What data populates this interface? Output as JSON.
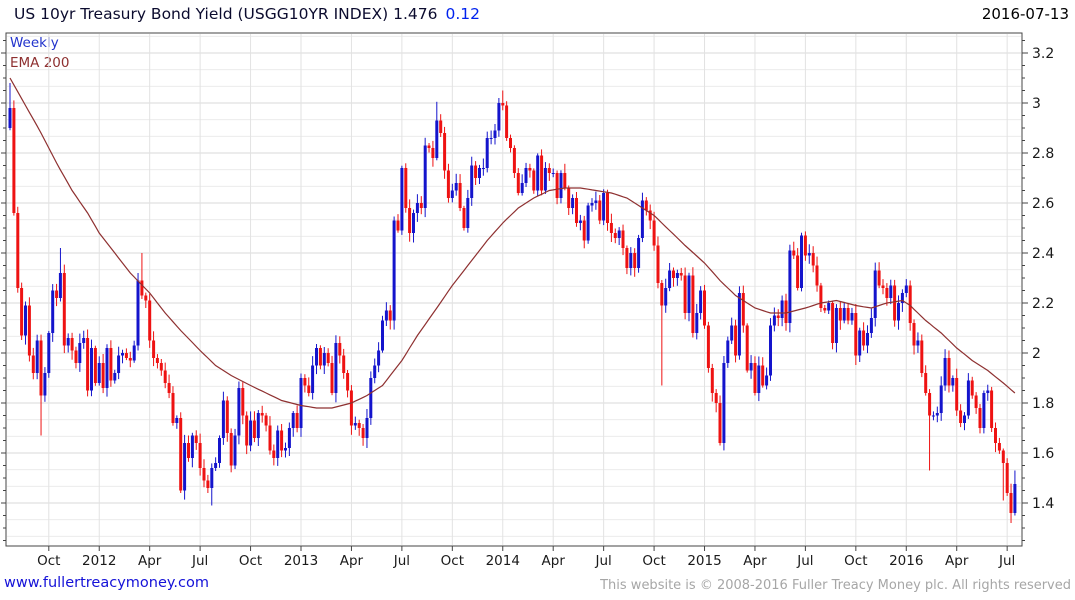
{
  "header": {
    "title": "US 10yr Treasury Bond Yield (USGG10YR INDEX) 1.476",
    "change": "0.12",
    "date": "2016-07-13"
  },
  "legend": {
    "frequency": "Weekly",
    "overlay": "EMA 200"
  },
  "footer": {
    "site": "www.fullertreacymoney.com",
    "copyright": "This website is © 2008-2016 Fuller Treacy Money plc. All rights reserved"
  },
  "chart_data": {
    "type": "candlestick",
    "title": "US 10yr Treasury Bond Yield (USGG10YR INDEX)",
    "frequency": "Weekly",
    "last_price": 1.476,
    "change": 0.12,
    "as_of": "2016-07-13",
    "start_week": "2011-07-29",
    "y_axis": {
      "min": 1.23,
      "max": 3.28,
      "tick_values": [
        1.4,
        1.6,
        1.8,
        2.0,
        2.2,
        2.4,
        2.6,
        2.8,
        3.0,
        3.2
      ],
      "tick_labels": [
        "1.4",
        "1.6",
        "1.8",
        "2",
        "2.2",
        "2.4",
        "2.6",
        "2.8",
        "3",
        "3.2"
      ]
    },
    "x_axis": {
      "ticks": [
        {
          "label": "Oct",
          "week": 10
        },
        {
          "label": "2012",
          "week": 23
        },
        {
          "label": "Apr",
          "week": 36
        },
        {
          "label": "Jul",
          "week": 49
        },
        {
          "label": "Oct",
          "week": 62
        },
        {
          "label": "2013",
          "week": 75
        },
        {
          "label": "Apr",
          "week": 88
        },
        {
          "label": "Jul",
          "week": 101
        },
        {
          "label": "Oct",
          "week": 114
        },
        {
          "label": "2014",
          "week": 127
        },
        {
          "label": "Apr",
          "week": 140
        },
        {
          "label": "Jul",
          "week": 153
        },
        {
          "label": "Oct",
          "week": 166
        },
        {
          "label": "2015",
          "week": 179
        },
        {
          "label": "Apr",
          "week": 192
        },
        {
          "label": "Jul",
          "week": 205
        },
        {
          "label": "Oct",
          "week": 218
        },
        {
          "label": "2016",
          "week": 231
        },
        {
          "label": "Apr",
          "week": 244
        },
        {
          "label": "Jul",
          "week": 257
        }
      ]
    },
    "open_first": 2.9,
    "weekly_closes": [
      2.98,
      2.56,
      2.26,
      2.07,
      2.19,
      1.99,
      1.92,
      2.05,
      1.83,
      1.92,
      2.08,
      2.25,
      2.22,
      2.32,
      2.03,
      2.06,
      2.01,
      1.96,
      2.04,
      2.06,
      1.85,
      2.02,
      1.88,
      1.96,
      1.86,
      2.02,
      1.89,
      1.92,
      1.99,
      2.0,
      1.98,
      1.97,
      2.03,
      2.29,
      2.23,
      2.21,
      2.05,
      1.98,
      1.96,
      1.93,
      1.88,
      1.84,
      1.72,
      1.74,
      1.45,
      1.64,
      1.58,
      1.67,
      1.64,
      1.54,
      1.49,
      1.46,
      1.54,
      1.56,
      1.66,
      1.81,
      1.68,
      1.55,
      1.67,
      1.86,
      1.75,
      1.63,
      1.73,
      1.66,
      1.76,
      1.75,
      1.71,
      1.61,
      1.58,
      1.69,
      1.61,
      1.62,
      1.7,
      1.76,
      1.7,
      1.9,
      1.87,
      1.84,
      1.95,
      2.02,
      1.95,
      2.0,
      1.96,
      1.84,
      2.04,
      1.99,
      1.92,
      1.85,
      1.71,
      1.72,
      1.7,
      1.66,
      1.74,
      1.9,
      1.95,
      2.01,
      2.13,
      2.17,
      2.13,
      2.53,
      2.49,
      2.74,
      2.58,
      2.48,
      2.56,
      2.6,
      2.58,
      2.83,
      2.82,
      2.78,
      2.93,
      2.88,
      2.73,
      2.62,
      2.65,
      2.68,
      2.58,
      2.5,
      2.62,
      2.75,
      2.7,
      2.74,
      2.74,
      2.86,
      2.86,
      2.89,
      3.0,
      2.99,
      2.86,
      2.82,
      2.72,
      2.64,
      2.68,
      2.74,
      2.73,
      2.65,
      2.79,
      2.65,
      2.74,
      2.72,
      2.72,
      2.62,
      2.72,
      2.66,
      2.58,
      2.62,
      2.52,
      2.53,
      2.45,
      2.59,
      2.6,
      2.61,
      2.53,
      2.64,
      2.52,
      2.48,
      2.46,
      2.49,
      2.42,
      2.34,
      2.4,
      2.34,
      2.46,
      2.61,
      2.57,
      2.53,
      2.43,
      2.28,
      2.19,
      2.26,
      2.33,
      2.3,
      2.32,
      2.31,
      2.16,
      2.31,
      2.08,
      2.16,
      2.25,
      2.11,
      1.94,
      1.84,
      1.8,
      1.64,
      1.96,
      2.05,
      2.11,
      1.99,
      2.24,
      2.11,
      1.93,
      1.96,
      1.84,
      1.95,
      1.87,
      1.91,
      2.11,
      2.15,
      2.14,
      2.21,
      2.12,
      2.41,
      2.39,
      2.26,
      2.47,
      2.39,
      2.4,
      2.35,
      2.27,
      2.18,
      2.17,
      2.2,
      2.04,
      2.18,
      2.13,
      2.18,
      2.13,
      2.16,
      1.99,
      2.09,
      2.03,
      2.08,
      2.14,
      2.33,
      2.27,
      2.26,
      2.22,
      2.27,
      2.13,
      2.2,
      2.24,
      2.27,
      2.12,
      2.03,
      2.05,
      1.92,
      1.84,
      1.75,
      1.75,
      1.76,
      1.87,
      1.98,
      1.87,
      1.9,
      1.77,
      1.72,
      1.75,
      1.89,
      1.83,
      1.78,
      1.7,
      1.84,
      1.85,
      1.7,
      1.64,
      1.61,
      1.56,
      1.44,
      1.36,
      1.476
    ],
    "wick_overrides": {
      "0": {
        "h": 3.08
      },
      "8": {
        "l": 1.67
      },
      "13": {
        "h": 2.42
      },
      "33": {
        "h": 2.32
      },
      "34": {
        "h": 2.4
      },
      "44": {
        "l": 1.44
      },
      "52": {
        "l": 1.39
      },
      "92": {
        "l": 1.62
      },
      "110": {
        "h": 3.005
      },
      "126": {
        "h": 3.02
      },
      "127": {
        "h": 3.05
      },
      "168": {
        "l": 1.87
      },
      "183": {
        "l": 1.63
      },
      "237": {
        "l": 1.53
      },
      "256": {
        "l": 1.41
      },
      "258": {
        "l": 1.32
      },
      "259": {
        "h": 1.53,
        "l": 1.35
      }
    },
    "ema200": {
      "label": "EMA 200",
      "anchors": [
        [
          0,
          3.1
        ],
        [
          4,
          2.99
        ],
        [
          8,
          2.88
        ],
        [
          12,
          2.76
        ],
        [
          16,
          2.65
        ],
        [
          20,
          2.56
        ],
        [
          23,
          2.48
        ],
        [
          27,
          2.4
        ],
        [
          31,
          2.32
        ],
        [
          36,
          2.24
        ],
        [
          40,
          2.16
        ],
        [
          44,
          2.09
        ],
        [
          49,
          2.01
        ],
        [
          53,
          1.95
        ],
        [
          57,
          1.91
        ],
        [
          62,
          1.87
        ],
        [
          66,
          1.84
        ],
        [
          70,
          1.81
        ],
        [
          75,
          1.79
        ],
        [
          79,
          1.78
        ],
        [
          83,
          1.78
        ],
        [
          88,
          1.8
        ],
        [
          92,
          1.83
        ],
        [
          96,
          1.87
        ],
        [
          101,
          1.97
        ],
        [
          105,
          2.07
        ],
        [
          110,
          2.18
        ],
        [
          114,
          2.27
        ],
        [
          118,
          2.35
        ],
        [
          123,
          2.45
        ],
        [
          127,
          2.52
        ],
        [
          131,
          2.58
        ],
        [
          135,
          2.62
        ],
        [
          139,
          2.65
        ],
        [
          143,
          2.66
        ],
        [
          147,
          2.66
        ],
        [
          151,
          2.65
        ],
        [
          155,
          2.64
        ],
        [
          159,
          2.62
        ],
        [
          163,
          2.58
        ],
        [
          166,
          2.55
        ],
        [
          170,
          2.49
        ],
        [
          174,
          2.43
        ],
        [
          179,
          2.36
        ],
        [
          183,
          2.29
        ],
        [
          187,
          2.23
        ],
        [
          192,
          2.18
        ],
        [
          196,
          2.16
        ],
        [
          200,
          2.16
        ],
        [
          205,
          2.18
        ],
        [
          209,
          2.2
        ],
        [
          213,
          2.21
        ],
        [
          218,
          2.19
        ],
        [
          222,
          2.18
        ],
        [
          226,
          2.2
        ],
        [
          230,
          2.21
        ],
        [
          232,
          2.19
        ],
        [
          236,
          2.13
        ],
        [
          240,
          2.08
        ],
        [
          244,
          2.02
        ],
        [
          248,
          1.97
        ],
        [
          252,
          1.93
        ],
        [
          256,
          1.88
        ],
        [
          259,
          1.84
        ]
      ]
    },
    "colors": {
      "up": "#1414cc",
      "down": "#ee1212",
      "ema": "#8e3030",
      "grid_minor": "#ececec",
      "grid_major": "#d9d9d9",
      "grid_vertical": "#e2e2e2",
      "axis": "#444444",
      "tick_text": "#1a1a1a"
    },
    "wick_noise": {
      "base": 0.008,
      "amp": 0.03
    },
    "legend_position": "top-left",
    "grid": true
  }
}
